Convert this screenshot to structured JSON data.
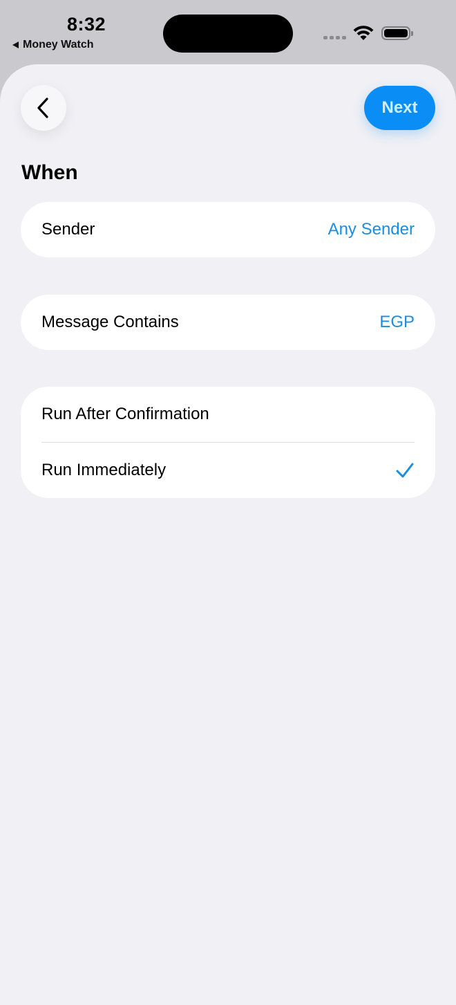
{
  "status_bar": {
    "time": "8:32",
    "back_app": "Money Watch",
    "icons": [
      "signal-icon",
      "wifi-icon",
      "battery-icon"
    ]
  },
  "nav": {
    "back_icon": "chevron-left-icon",
    "next_label": "Next"
  },
  "section": {
    "title": "When"
  },
  "sender_row": {
    "label": "Sender",
    "value": "Any Sender"
  },
  "message_row": {
    "label": "Message Contains",
    "value": "EGP"
  },
  "run_options": [
    {
      "label": "Run After Confirmation",
      "selected": false
    },
    {
      "label": "Run Immediately",
      "selected": true
    }
  ],
  "colors": {
    "accent": "#0a8df5",
    "value_text": "#1a8de0",
    "background": "#f0f0f5",
    "card": "#ffffff"
  }
}
